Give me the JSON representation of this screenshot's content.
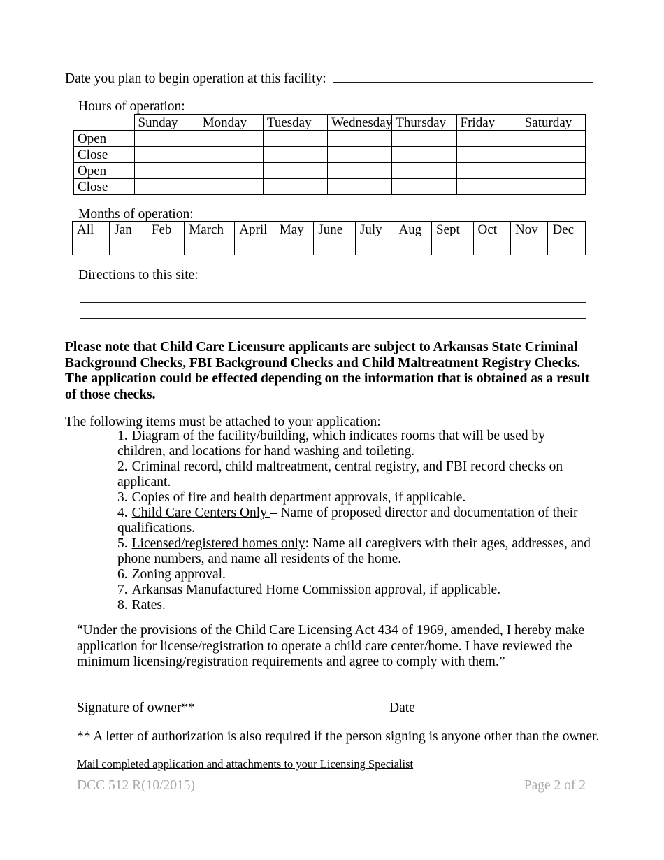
{
  "form": {
    "begin_date_label": "Date you plan to begin operation at this facility:",
    "begin_date_value": ""
  },
  "hours_section": {
    "caption": "Hours of operation:",
    "corner_label": "",
    "day_headers": [
      "Sunday",
      "Monday",
      "Tuesday",
      "Wednesday",
      "Thursday",
      "Friday",
      "Saturday"
    ],
    "rows": [
      {
        "label": "Open",
        "values": [
          "",
          "",
          "",
          "",
          "",
          "",
          ""
        ]
      },
      {
        "label": "Close",
        "values": [
          "",
          "",
          "",
          "",
          "",
          "",
          ""
        ]
      },
      {
        "label": "Open",
        "values": [
          "",
          "",
          "",
          "",
          "",
          "",
          ""
        ]
      },
      {
        "label": "Close",
        "values": [
          "",
          "",
          "",
          "",
          "",
          "",
          ""
        ]
      }
    ]
  },
  "months_section": {
    "caption": "Months of operation:",
    "headers": [
      "All",
      "Jan",
      "Feb",
      "March",
      "April",
      "May",
      "June",
      "July",
      "Aug",
      "Sept",
      "Oct",
      "Nov",
      "Dec"
    ],
    "values": [
      "",
      "",
      "",
      "",
      "",
      "",
      "",
      "",
      "",
      "",
      "",
      "",
      ""
    ]
  },
  "directions_section": {
    "caption": "Directions to this site:",
    "lines": [
      "",
      "",
      ""
    ]
  },
  "notice": {
    "text": "Please note that Child Care Licensure applicants are subject to Arkansas State Criminal Background Checks, FBI Background Checks and Child Maltreatment Registry Checks. The application could be effected depending on the information that is obtained as a result of those checks."
  },
  "attachments": {
    "intro": "The following items must be attached to your application:",
    "items": [
      {
        "num": "1.",
        "underlined": "",
        "text": "Diagram of the facility/building, which indicates rooms that will be used by children, and locations for hand washing and toileting."
      },
      {
        "num": "2.",
        "underlined": "",
        "text": "Criminal record, child maltreatment, central registry, and FBI record checks on applicant."
      },
      {
        "num": "3.",
        "underlined": "",
        "text": "Copies of fire and health department approvals, if applicable."
      },
      {
        "num": "4.",
        "underlined": "Child Care Centers Only ",
        "text": "– Name of proposed director and documentation of their qualifications."
      },
      {
        "num": "5.",
        "underlined": "Licensed/registered homes only",
        "text": ": Name all caregivers with their ages, addresses, and phone numbers, and name all residents of the home."
      },
      {
        "num": "6.",
        "underlined": "",
        "text": "Zoning approval."
      },
      {
        "num": "7.",
        "underlined": "",
        "text": "Arkansas Manufactured Home Commission approval, if applicable."
      },
      {
        "num": "8.",
        "underlined": "",
        "text": "Rates."
      }
    ]
  },
  "statement": {
    "text": "“Under the provisions of the Child Care Licensing Act 434 of 1969, amended, I hereby make application for license/registration to operate a child care center/home. I have reviewed the minimum licensing/registration requirements and agree to comply with them.”"
  },
  "signature": {
    "owner_label": "Signature of owner**",
    "owner_value": "",
    "date_label": "Date",
    "date_value": "",
    "footnote": "** A letter of authorization is also required if the person signing is anyone other than the owner.",
    "mailing_instruction": "Mail completed application and attachments to your Licensing Specialist"
  },
  "footer": {
    "form_number": "DCC 512 R(10/2015)",
    "page_number": "Page 2 of 2",
    "color": "#a9a9a9"
  }
}
